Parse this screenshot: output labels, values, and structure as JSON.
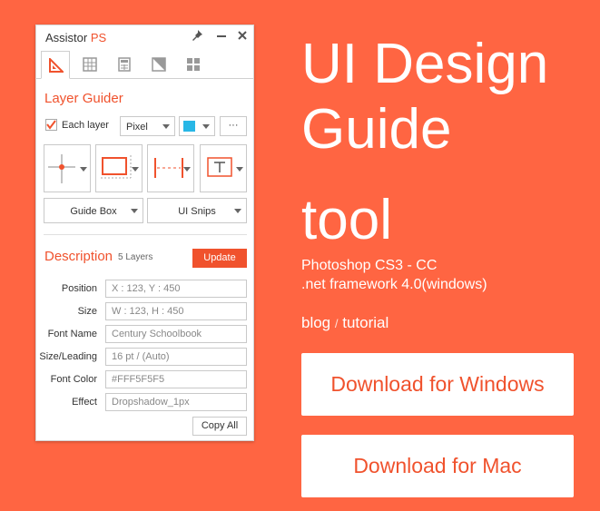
{
  "panel": {
    "title_main": "Assistor",
    "title_accent": "PS",
    "title_icons": [
      "pin-icon",
      "minimize-icon",
      "close-icon"
    ],
    "tabs": [
      "layer-guider-tab-icon",
      "grid-tab-icon",
      "calculator-tab-icon",
      "shape-tab-icon",
      "tiles-tab-icon"
    ],
    "layer_guider": {
      "heading": "Layer Guider",
      "each_layer_label": "Each layer",
      "each_layer_checked": true,
      "unit_value": "Pixel",
      "color_value": "#28B7E6",
      "more_label": "···",
      "tools": [
        "crosshair-guide-icon",
        "guide-box-icon",
        "vertical-guides-icon",
        "text-guide-icon"
      ],
      "guide_box_label": "Guide Box",
      "ui_snips_label": "UI Snips"
    },
    "description": {
      "heading": "Description",
      "layers_count": "5 Layers",
      "update_label": "Update",
      "rows": [
        {
          "label": "Position",
          "value": "X : 123, Y : 450"
        },
        {
          "label": "Size",
          "value": "W : 123, H : 450"
        },
        {
          "label": "Font Name",
          "value": "Century Schoolbook"
        },
        {
          "label": "Size/Leading",
          "value": "16 pt / (Auto)"
        },
        {
          "label": "Font Color",
          "value": "#FFF5F5F5"
        },
        {
          "label": "Effect",
          "value": "Dropshadow_1px"
        }
      ],
      "copy_all_label": "Copy All"
    }
  },
  "hero": {
    "line1": "UI Design",
    "line2": "Guide",
    "line3": "tool",
    "requirements1": "Photoshop CS3 - CC",
    "requirements2": ".net framework 4.0(windows)",
    "link_blog": "blog",
    "link_sep": "/",
    "link_tutorial": "tutorial",
    "download_windows": "Download for Windows",
    "download_mac": "Download for Mac"
  },
  "colors": {
    "background": "#FF6542",
    "accent": "#F0522D",
    "swatch": "#28B7E6"
  }
}
